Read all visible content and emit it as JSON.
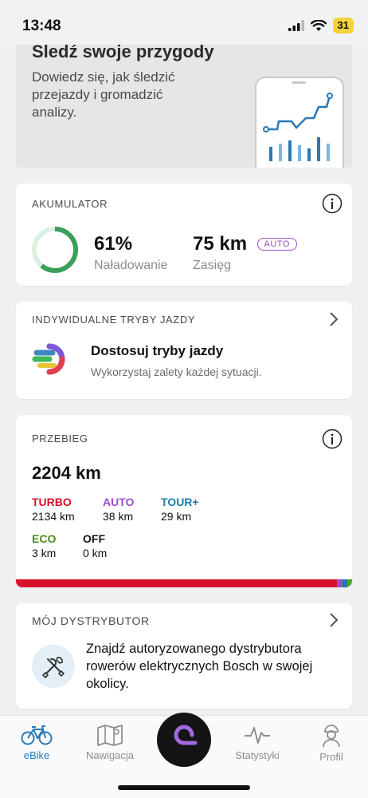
{
  "status_bar": {
    "time": "13:48",
    "battery": "31"
  },
  "promo": {
    "title": "Śledź swoje przygody",
    "text": "Dowiedz się, jak śledzić przejazdy i gromadzić analizy."
  },
  "battery": {
    "section_label": "AKUMULATOR",
    "charge_value": "61%",
    "charge_label": "Naładowanie",
    "charge_fraction": 0.61,
    "range_value": "75 km",
    "range_label": "Zasięg",
    "range_badge": "AUTO"
  },
  "riding_modes": {
    "section_label": "INDYWIDUALNE TRYBY JAZDY",
    "title": "Dostosuj tryby jazdy",
    "subtitle": "Wykorzystaj zalety każdej sytuacji."
  },
  "mileage": {
    "section_label": "PRZEBIEG",
    "total": "2204 km",
    "modes": [
      {
        "name": "TURBO",
        "value": "2134 km",
        "color": "#d6102a"
      },
      {
        "name": "AUTO",
        "value": "38 km",
        "color": "#9b4dca"
      },
      {
        "name": "TOUR+",
        "value": "29 km",
        "color": "#1a7ea8"
      },
      {
        "name": "ECO",
        "value": "3 km",
        "color": "#4a8a1c"
      },
      {
        "name": "OFF",
        "value": "0 km",
        "color": "#111111"
      }
    ]
  },
  "dealer": {
    "section_label": "MÓJ DYSTRYBUTOR",
    "text": "Znajdź autoryzowanego dystrybutora rowerów elektrycznych Bosch w swojej okolicy."
  },
  "nav": {
    "ebike": "eBike",
    "navigation": "Nawigacja",
    "statistics": "Statystyki",
    "profile": "Profil"
  },
  "colors": {
    "accent_blue": "#2a79b6",
    "battery_green": "#3aa05a",
    "background": "#eef0f2"
  }
}
